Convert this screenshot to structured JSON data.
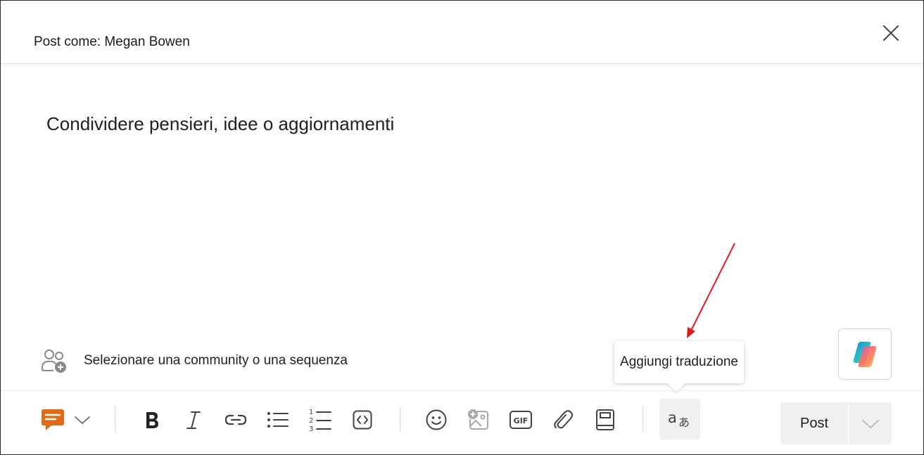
{
  "header": {
    "post_as": "Post come: Megan Bowen"
  },
  "editor": {
    "placeholder": "Condividere pensieri, idee o aggiornamenti"
  },
  "community": {
    "label": "Selezionare una community o una sequenza"
  },
  "tooltip": {
    "text": "Aggiungi traduzione"
  },
  "toolbar": {
    "post_type_color": "#e06a18",
    "items": [
      {
        "name": "bold-icon"
      },
      {
        "name": "italic-icon"
      },
      {
        "name": "link-icon"
      },
      {
        "name": "bullet-list-icon"
      },
      {
        "name": "numbered-list-icon"
      },
      {
        "name": "code-block-icon"
      },
      {
        "name": "emoji-icon"
      },
      {
        "name": "add-image-icon"
      },
      {
        "name": "gif-icon"
      },
      {
        "name": "attachment-icon"
      },
      {
        "name": "book-icon"
      },
      {
        "name": "translate-icon"
      }
    ],
    "post_label": "Post"
  },
  "colors": {
    "annotation_arrow": "#e01b1b",
    "icon_gray": "#424242"
  }
}
